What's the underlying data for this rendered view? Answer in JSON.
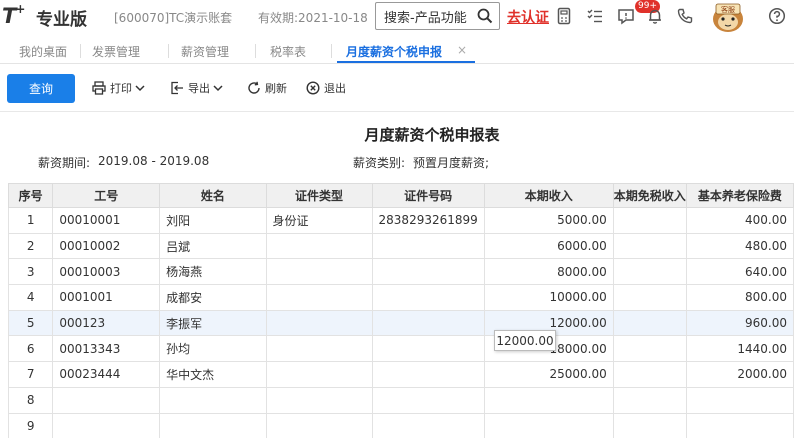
{
  "header": {
    "logo": "T",
    "logo_sup": "+",
    "product_name": "专业版",
    "account": "[600070]TC演示账套",
    "validity": "有效期:2021-10-18",
    "search_text": "搜索-产品功能",
    "certify_link": "去认证",
    "notification_badge": "99+",
    "mascot_label": "客服"
  },
  "tabs": [
    {
      "label": "我的桌面"
    },
    {
      "label": "发票管理"
    },
    {
      "label": "薪资管理"
    },
    {
      "label": "税率表"
    },
    {
      "label": "月度薪资个税申报",
      "active": true
    }
  ],
  "tab_close": "×",
  "toolbar": {
    "query": "查询",
    "print": "打印",
    "export": "导出",
    "refresh": "刷新",
    "exit": "退出"
  },
  "report": {
    "title": "月度薪资个税申报表",
    "period_label": "薪资期间:",
    "period_value": "2019.08 - 2019.08",
    "category_label": "薪资类别:",
    "category_value": "预置月度薪资;"
  },
  "table": {
    "columns": [
      "序号",
      "工号",
      "姓名",
      "证件类型",
      "证件号码",
      "本期收入",
      "本期免税收入",
      "基本养老保险费"
    ],
    "rows": [
      {
        "seq": "1",
        "id": "00010001",
        "name": "刘阳",
        "id_type": "身份证",
        "id_no": "2838293261899",
        "income": "5000.00",
        "tax_free": "",
        "pension": "400.00"
      },
      {
        "seq": "2",
        "id": "00010002",
        "name": "吕斌",
        "id_type": "",
        "id_no": "",
        "income": "6000.00",
        "tax_free": "",
        "pension": "480.00"
      },
      {
        "seq": "3",
        "id": "00010003",
        "name": "杨海燕",
        "id_type": "",
        "id_no": "",
        "income": "8000.00",
        "tax_free": "",
        "pension": "640.00"
      },
      {
        "seq": "4",
        "id": "0001001",
        "name": "成都安",
        "id_type": "",
        "id_no": "",
        "income": "10000.00",
        "tax_free": "",
        "pension": "800.00"
      },
      {
        "seq": "5",
        "id": "000123",
        "name": "李振军",
        "id_type": "",
        "id_no": "",
        "income": "12000.00",
        "tax_free": "",
        "pension": "960.00"
      },
      {
        "seq": "6",
        "id": "00013343",
        "name": "孙均",
        "id_type": "",
        "id_no": "",
        "income": "18000.00",
        "tax_free": "",
        "pension": "1440.00"
      },
      {
        "seq": "7",
        "id": "00023444",
        "name": "华中文杰",
        "id_type": "",
        "id_no": "",
        "income": "25000.00",
        "tax_free": "",
        "pension": "2000.00"
      },
      {
        "seq": "8",
        "id": "",
        "name": "",
        "id_type": "",
        "id_no": "",
        "income": "",
        "tax_free": "",
        "pension": ""
      },
      {
        "seq": "9",
        "id": "",
        "name": "",
        "id_type": "",
        "id_no": "",
        "income": "",
        "tax_free": "",
        "pension": ""
      }
    ]
  },
  "tooltip": "12000.00",
  "colors": {
    "accent": "#1a7fe8",
    "certify": "#e0312a",
    "header_bg": "#f0f0f0"
  }
}
